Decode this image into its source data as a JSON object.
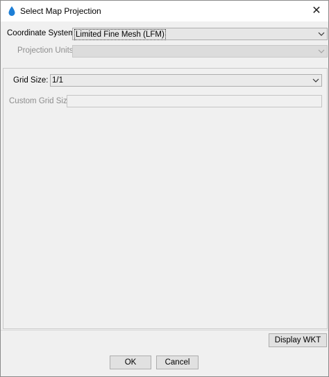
{
  "window": {
    "title": "Select Map Projection",
    "close_glyph": "✕"
  },
  "form": {
    "coordinate_system_label": "Coordinate System:",
    "coordinate_system_value": "Limited Fine Mesh (LFM)",
    "projection_units_label": "Projection Units:",
    "projection_units_value": "",
    "grid_size_label": "Grid Size:",
    "grid_size_value": "1/1",
    "custom_grid_size_label": "Custom Grid Size:",
    "custom_grid_size_value": ""
  },
  "buttons": {
    "display_wkt": "Display WKT",
    "ok": "OK",
    "cancel": "Cancel"
  },
  "icons": {
    "title_icon": "water-drop-icon",
    "dropdown": "chevron-down-icon"
  },
  "colors": {
    "drop_icon": "#1e7fd6",
    "disabled_text": "#8d8d8d"
  }
}
